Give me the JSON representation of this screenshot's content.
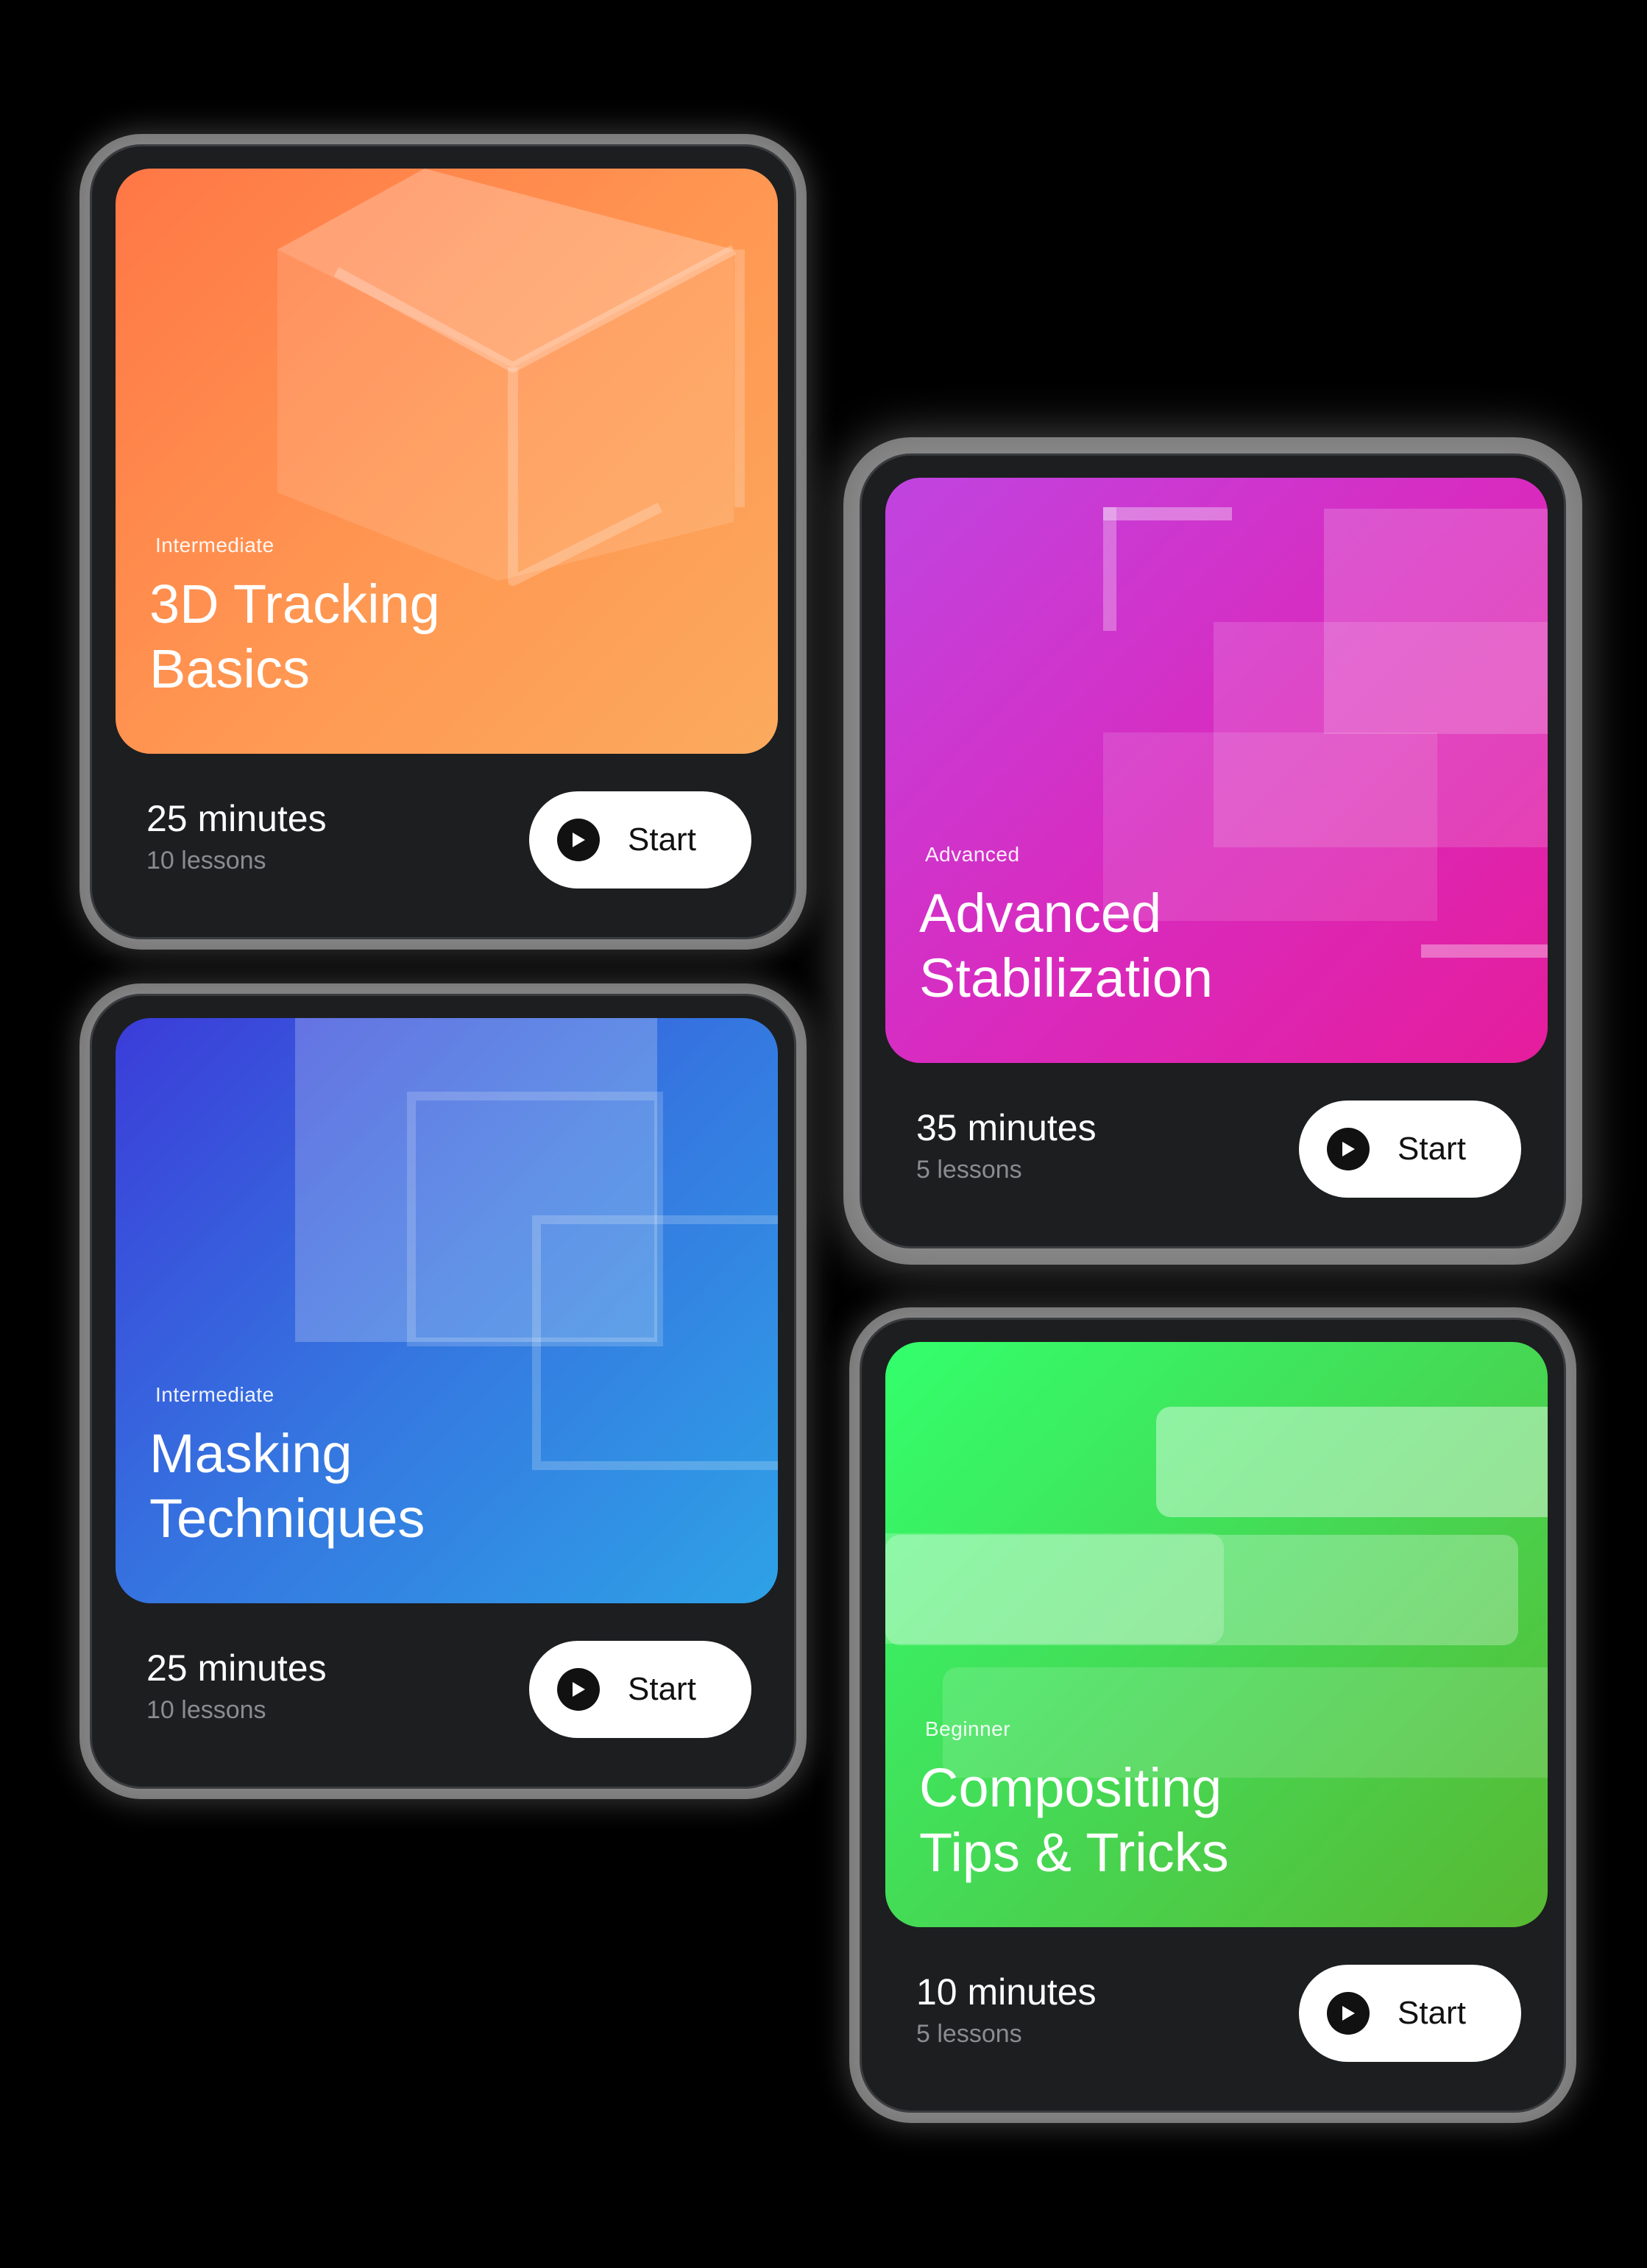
{
  "cards": [
    {
      "level": "Intermediate",
      "title_line1": "3D Tracking",
      "title_line2": "Basics",
      "duration": "25 minutes",
      "lessons": "10 lessons",
      "button_label": "Start",
      "gradient": [
        "#ff7a4a",
        "#fba95a"
      ]
    },
    {
      "level": "Advanced",
      "title_line1": "Advanced",
      "title_line2": "Stabilization",
      "duration": "35 minutes",
      "lessons": "5 lessons",
      "button_label": "Start",
      "gradient": [
        "#c445e0",
        "#e01e9e"
      ]
    },
    {
      "level": "Intermediate",
      "title_line1": "Masking",
      "title_line2": "Techniques",
      "duration": "25 minutes",
      "lessons": "10 lessons",
      "button_label": "Start",
      "gradient": [
        "#3d3ddb",
        "#2ea0e6"
      ]
    },
    {
      "level": "Beginner",
      "title_line1": "Compositing",
      "title_line2": "Tips & Tricks",
      "duration": "10 minutes",
      "lessons": "5 lessons",
      "button_label": "Start",
      "gradient": [
        "#33ff6e",
        "#56b832"
      ]
    }
  ],
  "icons": {
    "play": "play-icon"
  }
}
